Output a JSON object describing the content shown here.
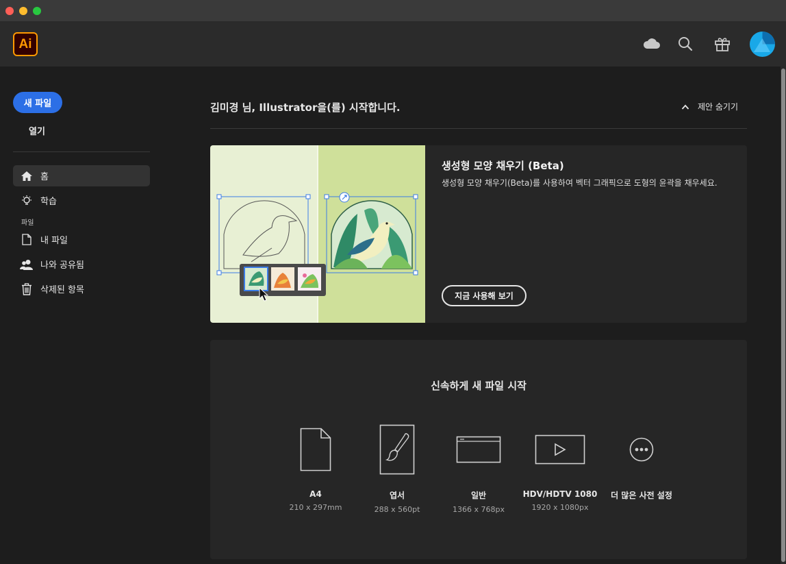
{
  "app": {
    "logo_text": "Ai"
  },
  "sidebar": {
    "new_file": "새 파일",
    "open": "열기",
    "section_files": "파일",
    "items": [
      {
        "label": "홈",
        "icon": "home-icon"
      },
      {
        "label": "학습",
        "icon": "lightbulb-icon"
      },
      {
        "label": "내 파일",
        "icon": "file-icon"
      },
      {
        "label": "나와 공유됨",
        "icon": "shared-users-icon"
      },
      {
        "label": "삭제된 항목",
        "icon": "trash-icon"
      }
    ]
  },
  "main": {
    "welcome": "김미경 님, Illustrator을(를) 시작합니다.",
    "hide_suggestions": "제안 숨기기",
    "promo": {
      "title": "생성형 모양 채우기 (Beta)",
      "description": "생성형 모양 채우기(Beta)를 사용하여 벡터 그래픽으로 도형의 윤곽을 채우세요.",
      "button": "지금 사용해 보기"
    },
    "quick_start": {
      "title": "신속하게 새 파일 시작",
      "presets": [
        {
          "name": "A4",
          "size": "210 x 297mm",
          "icon": "document-icon"
        },
        {
          "name": "엽서",
          "size": "288 x 560pt",
          "icon": "brush-icon"
        },
        {
          "name": "일반",
          "size": "1366 x 768px",
          "icon": "browser-icon"
        },
        {
          "name": "HDV/HDTV 1080",
          "size": "1920 x 1080px",
          "icon": "video-play-icon"
        },
        {
          "name": "더 많은 사전 설정",
          "size": "",
          "icon": "more-icon"
        }
      ]
    }
  },
  "colors": {
    "accent": "#2c6fe6",
    "brand": "#ff9a00",
    "avatar": "#19a8e8"
  }
}
